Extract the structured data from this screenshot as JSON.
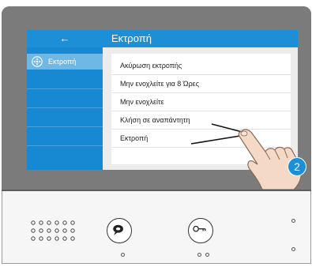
{
  "screen": {
    "back_label": "←",
    "title": "Εκτροπή"
  },
  "sidebar": {
    "items": [
      {
        "label": "Εκτροπή",
        "icon": "dpad-icon",
        "selected": true
      }
    ]
  },
  "menu": {
    "items": [
      {
        "label": "Ακύρωση εκτροπής"
      },
      {
        "label": "Μην ενοχλείτε για 8 Ώρες"
      },
      {
        "label": "Μην ενοχλείτε"
      },
      {
        "label": "Κλήση σε αναπάντητη"
      },
      {
        "label": "Εκτροπή"
      }
    ]
  },
  "annotation": {
    "step_number": "2"
  },
  "colors": {
    "accent": "#1d8fd6",
    "sidebar": "#1689d2",
    "sidebar_selected": "#6fb8e6",
    "bezel": "#7b7b7b"
  },
  "hardware": {
    "talk_button_icon": "speech-bubble-icon",
    "unlock_button_icon": "key-icon"
  }
}
